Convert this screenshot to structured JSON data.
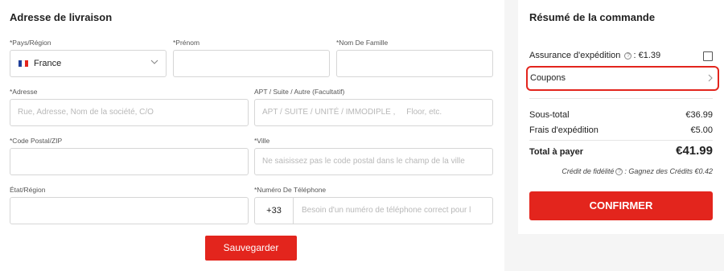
{
  "shipping": {
    "title": "Adresse de livraison",
    "country": {
      "label": "*Pays/Région",
      "value": "France",
      "flag_colors": [
        "#1f3f99",
        "#ffffff",
        "#e3251d"
      ]
    },
    "firstname": {
      "label": "*Prénom",
      "placeholder": ""
    },
    "lastname": {
      "label": "*Nom De Famille",
      "placeholder": ""
    },
    "address": {
      "label": "*Adresse",
      "placeholder": "Rue, Adresse, Nom de la société, C/O"
    },
    "apt": {
      "label": "APT / Suite / Autre (Facultatif)",
      "placeholder": "APT / SUITE / UNITÉ / IMMODIPLE ,     Floor, etc."
    },
    "zip": {
      "label": "*Code Postal/ZIP",
      "placeholder": ""
    },
    "city": {
      "label": "*Ville",
      "placeholder": "Ne saisissez pas le code postal dans le champ de la ville"
    },
    "state": {
      "label": "État/Région",
      "placeholder": ""
    },
    "phone": {
      "label": "*Numéro De Téléphone",
      "prefix": "+33",
      "placeholder": "Besoin d'un numéro de téléphone correct pour l"
    },
    "save_label": "Sauvegarder"
  },
  "summary": {
    "title": "Résumé de la commande",
    "insurance_label": "Assurance d'expédition",
    "insurance_price": ": €1.39",
    "insurance_checked": false,
    "coupons_label": "Coupons",
    "subtotal_label": "Sous-total",
    "subtotal_value": "€36.99",
    "shipping_label": "Frais d'expédition",
    "shipping_value": "€5.00",
    "total_label": "Total à payer",
    "total_value": "€41.99",
    "loyalty_prefix": "Crédit de fidélité",
    "loyalty_text": ": Gagnez des Crédits €0.42",
    "confirm_label": "CONFIRMER"
  },
  "colors": {
    "accent": "#e3251d",
    "border": "#d6d6d6",
    "panel_bg": "#f5f5f5"
  }
}
